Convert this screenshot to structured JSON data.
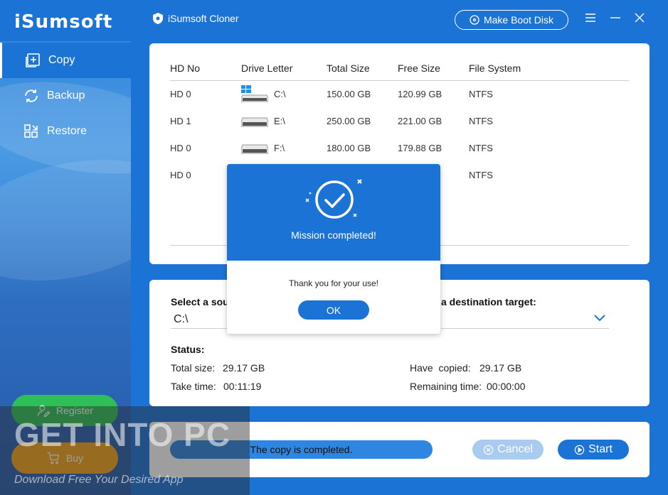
{
  "app": {
    "logo": "iSumsoft",
    "title": "iSumsoft Cloner",
    "boot_button": "Make Boot Disk"
  },
  "sidebar": {
    "items": [
      {
        "label": "Copy",
        "icon": "copy-icon",
        "active": true
      },
      {
        "label": "Backup",
        "icon": "backup-icon",
        "active": false
      },
      {
        "label": "Restore",
        "icon": "restore-icon",
        "active": false
      }
    ],
    "register": "Register",
    "buy": "Buy"
  },
  "drives": {
    "headers": [
      "HD No",
      "Drive Letter",
      "Total Size",
      "Free Size",
      "File System"
    ],
    "rows": [
      {
        "hd": "HD 0",
        "letter": "C:\\",
        "total": "150.00 GB",
        "free": "120.99 GB",
        "fs": "NTFS",
        "icon": "windows-drive-icon"
      },
      {
        "hd": "HD 1",
        "letter": "E:\\",
        "total": "250.00 GB",
        "free": "221.00 GB",
        "fs": "NTFS",
        "icon": "drive-icon"
      },
      {
        "hd": "HD 0",
        "letter": "F:\\",
        "total": "180.00 GB",
        "free": "179.88 GB",
        "fs": "NTFS",
        "icon": "drive-icon"
      },
      {
        "hd": "HD 0",
        "letter": "",
        "total": "",
        "free": "",
        "fs": "NTFS",
        "icon": ""
      }
    ]
  },
  "copy": {
    "source_label": "Select a sou",
    "source_value": "C:\\",
    "dest_label": "a destination target:",
    "status_label": "Status:",
    "total_size_label": "Total size:",
    "total_size": "29.17 GB",
    "take_time_label": "Take time:",
    "take_time": "00:11:19",
    "copied_label": "Have  copied:",
    "copied": "29.17 GB",
    "remaining_label": "Remaining time:",
    "remaining": "00:00:00"
  },
  "footer": {
    "progress_text": "The copy is completed.",
    "progress": 1.0,
    "cancel": "Cancel",
    "start": "Start"
  },
  "dialog": {
    "title": "Mission completed!",
    "message": "Thank you for your use!",
    "ok": "OK"
  },
  "watermark": {
    "title": "GET INTO PC",
    "subtitle": "Download Free Your Desired App"
  },
  "colors": {
    "primary": "#1c73d6",
    "register": "#2fbf58",
    "buy": "#f2a21a",
    "cancel_disabled": "#a9cbef"
  }
}
